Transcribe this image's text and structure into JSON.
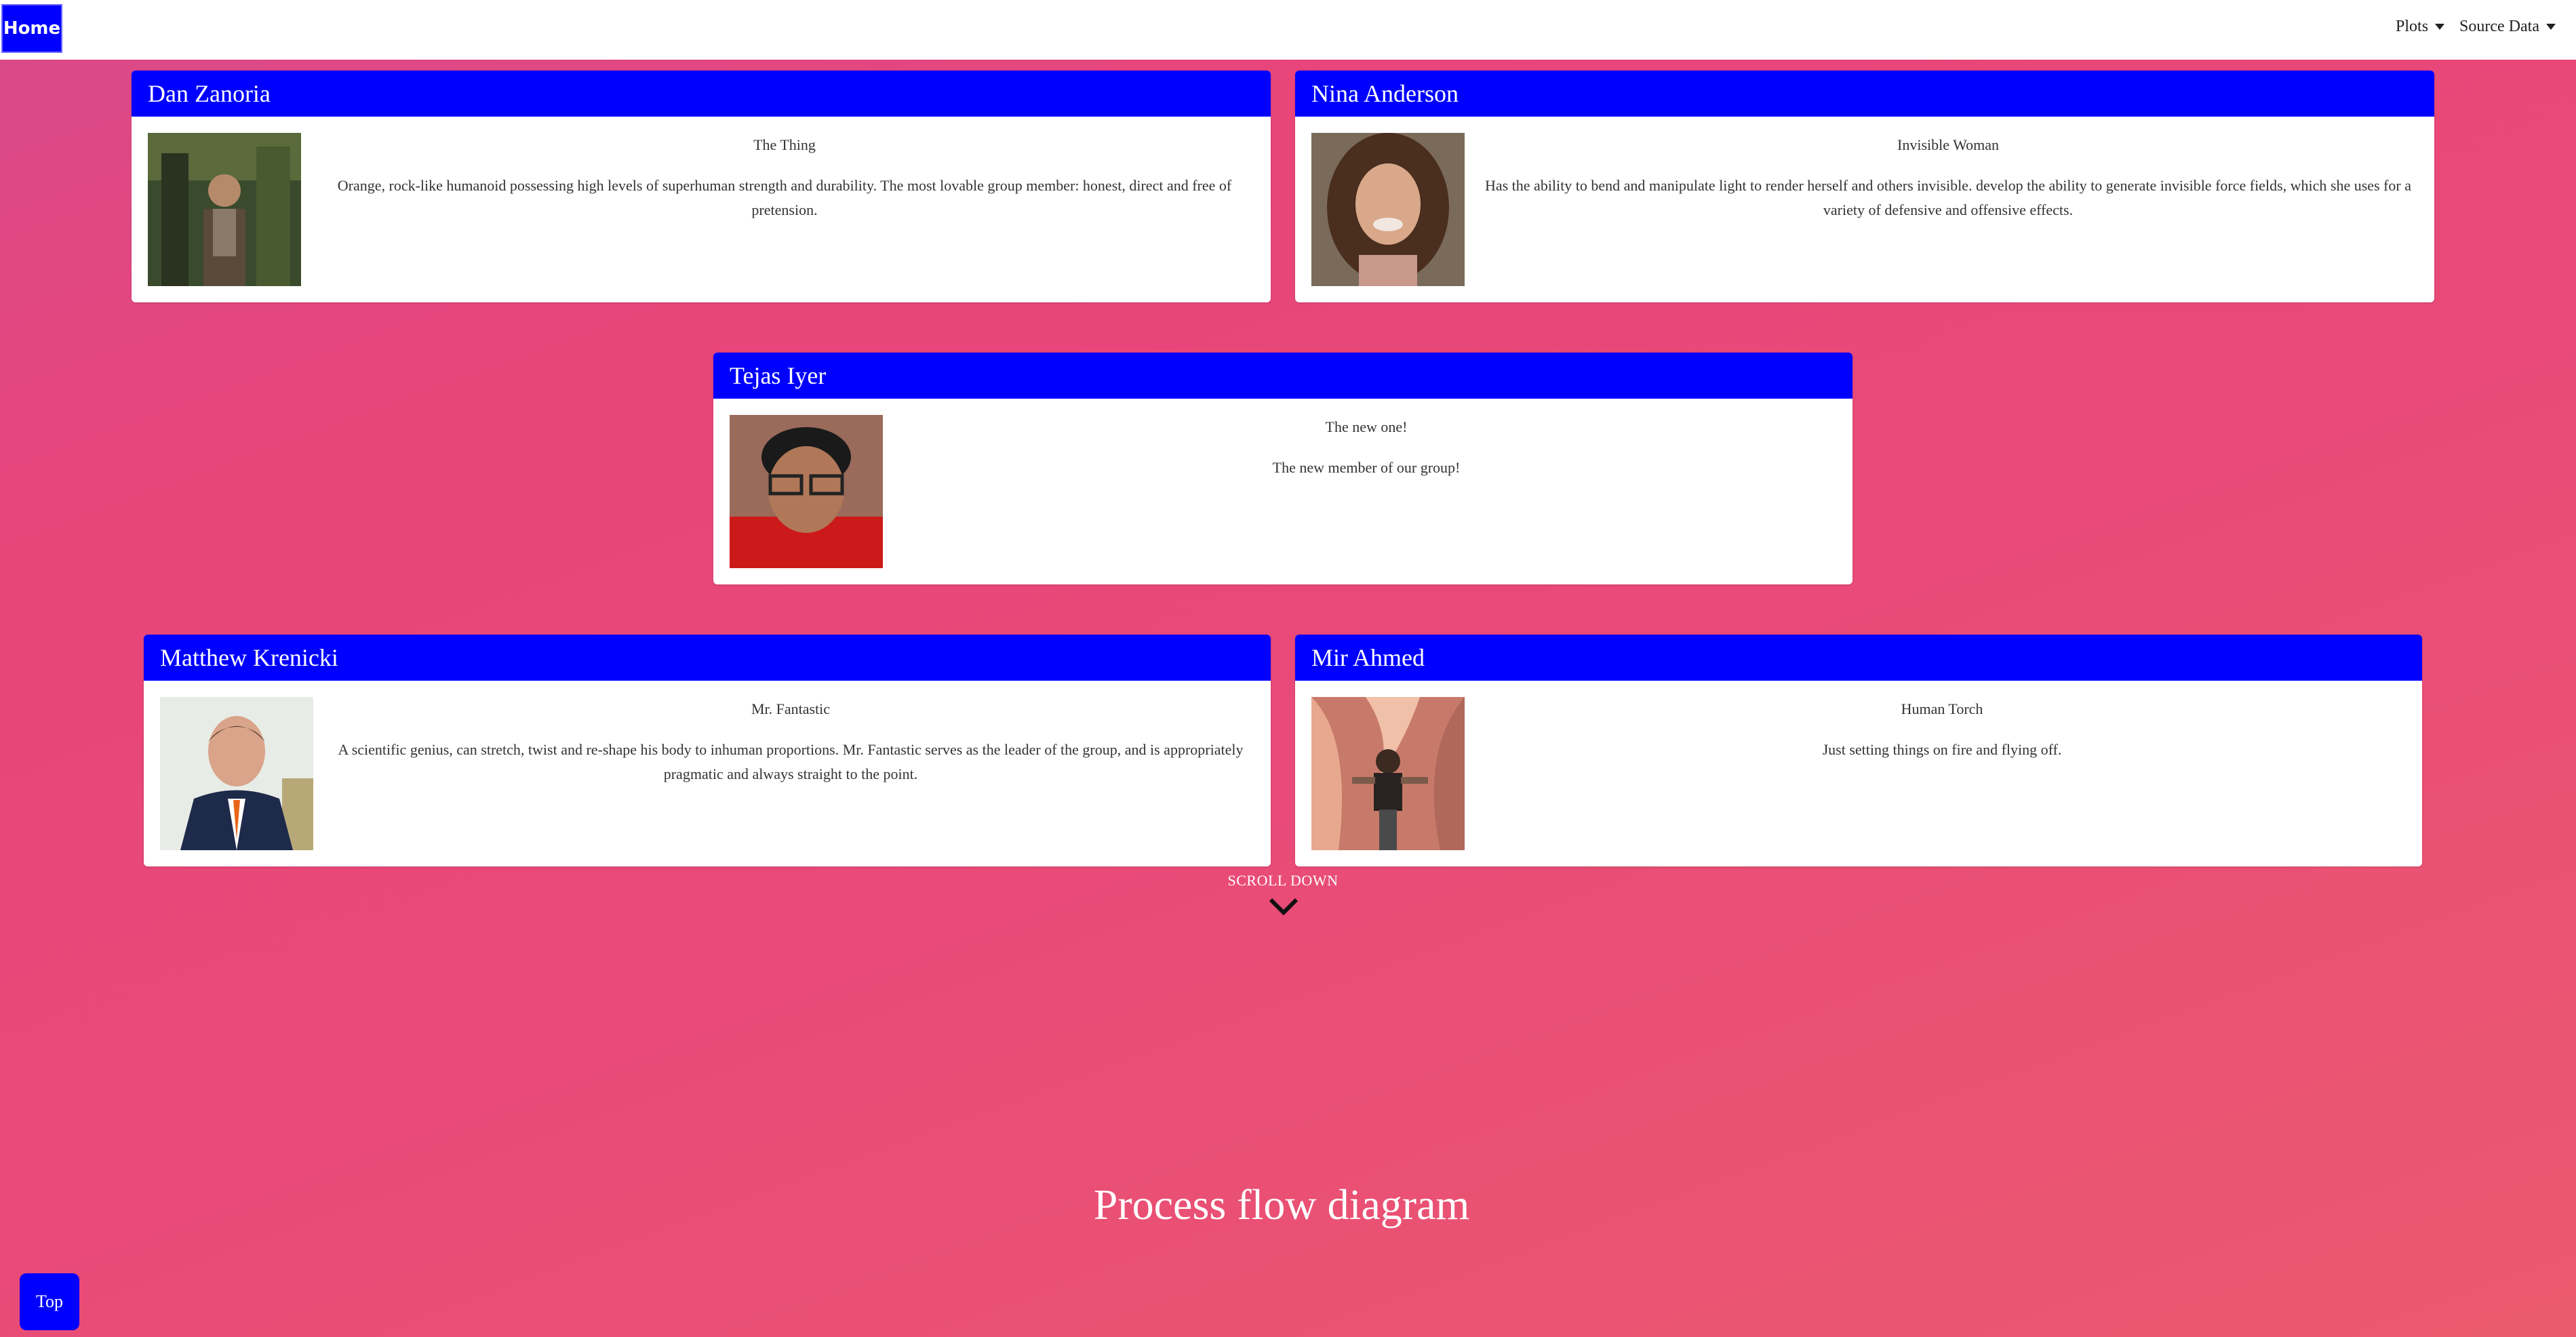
{
  "nav": {
    "home_label": "Home",
    "plots_label": "Plots",
    "source_data_label": "Source Data"
  },
  "cards": [
    {
      "name": "Dan Zanoria",
      "title": "The Thing",
      "desc": "Orange, rock-like humanoid possessing high levels of superhuman strength and durability. The most lovable group member: honest, direct and free of pretension."
    },
    {
      "name": "Nina Anderson",
      "title": "Invisible Woman",
      "desc": "Has the ability to bend and manipulate light to render herself and others invisible. develop the ability to generate invisible force fields, which she uses for a variety of defensive and offensive effects."
    },
    {
      "name": "Tejas Iyer",
      "title": "The new one!",
      "desc": "The new member of our group!"
    },
    {
      "name": "Matthew Krenicki",
      "title": "Mr. Fantastic",
      "desc": "A scientific genius, can stretch, twist and re-shape his body to inhuman proportions. Mr. Fantastic serves as the leader of the group, and is appropriately pragmatic and always straight to the point."
    },
    {
      "name": "Mir Ahmed",
      "title": "Human Torch",
      "desc": "Just setting things on fire and flying off."
    }
  ],
  "scroll_down_label": "SCROLL DOWN",
  "section_title": "Process flow diagram",
  "top_button_label": "Top",
  "colors": {
    "accent": "#0000ff",
    "background_start": "#d94a8a",
    "background_end": "#ea5a6e"
  },
  "icons": {
    "scroll": "chevron-down-icon",
    "nav_dropdown": "caret-down-icon"
  }
}
